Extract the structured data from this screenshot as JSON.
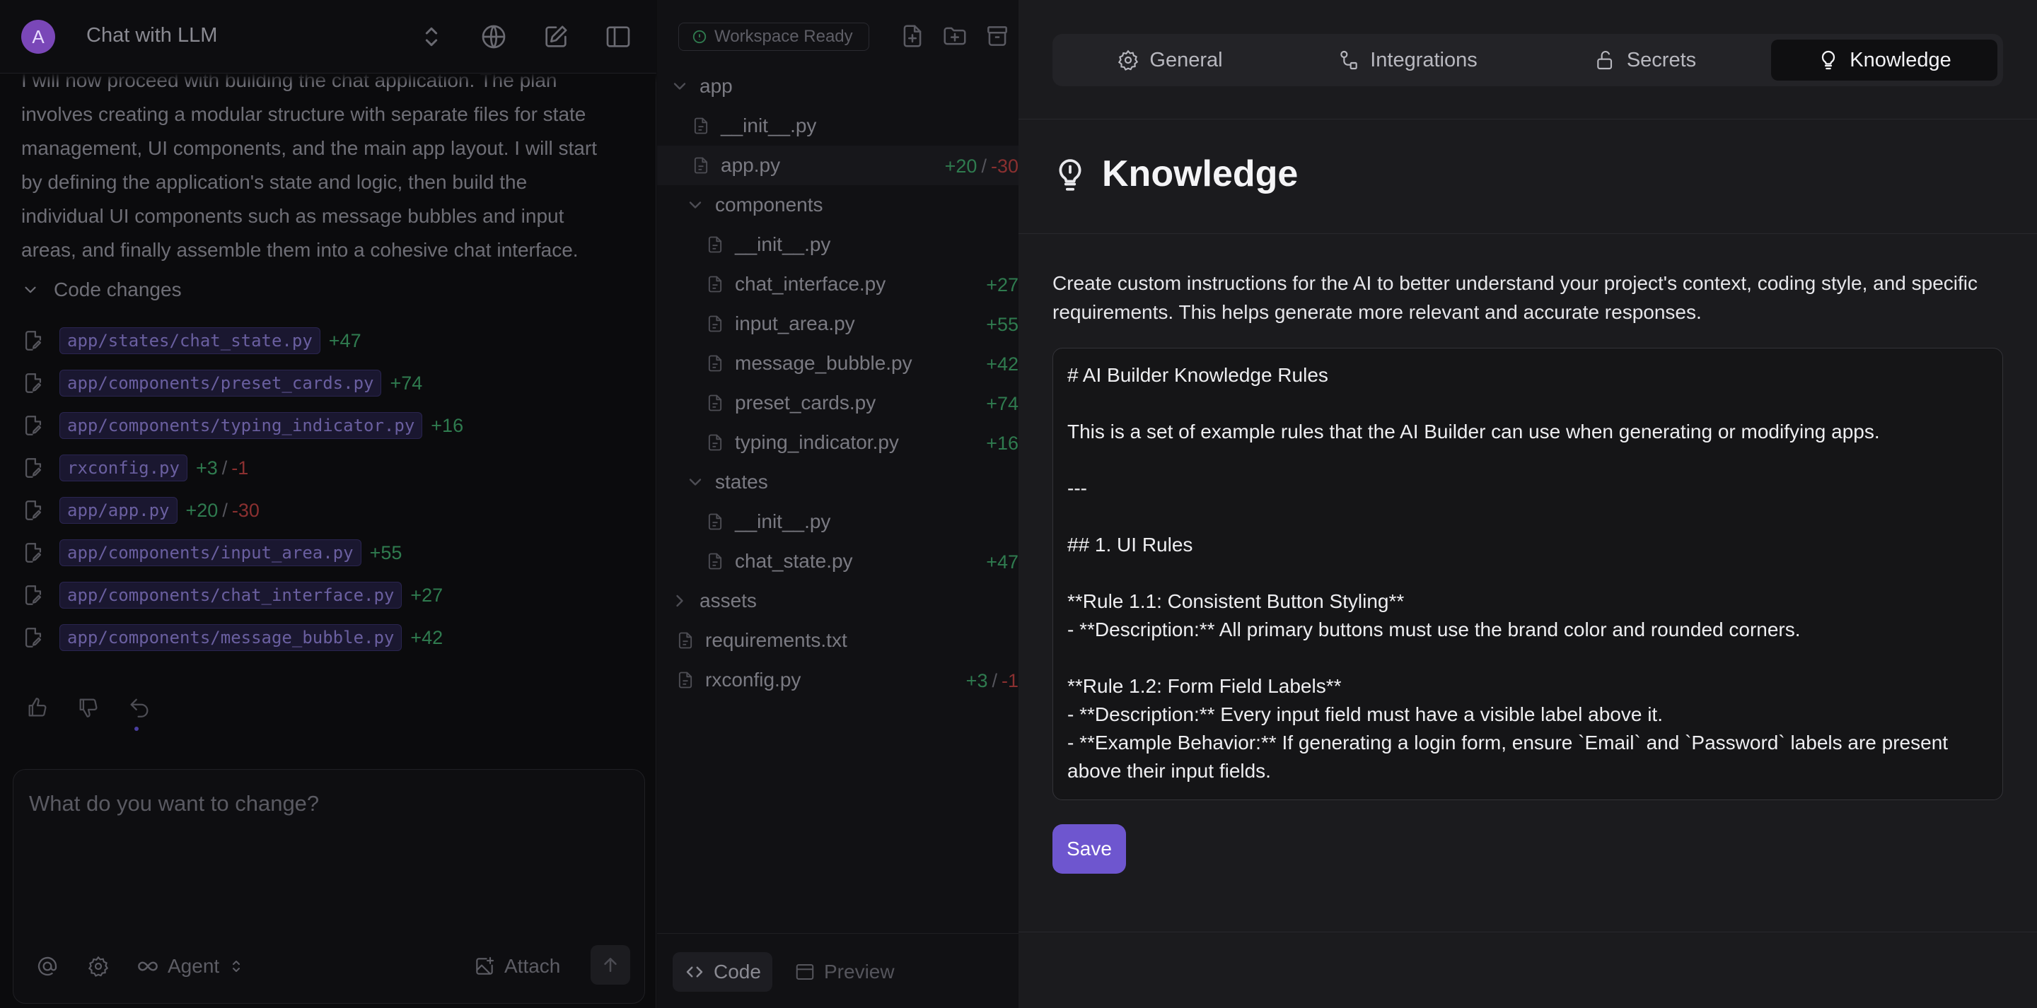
{
  "chat": {
    "avatar_letter": "A",
    "title": "Chat with LLM",
    "plan_lines": [
      "I will now proceed with building the chat application. The plan",
      "involves creating a modular structure with separate files for state",
      "management, UI components, and the main app layout. I will start",
      "by defining the application's state and logic, then build the",
      "individual UI components such as message bubbles and input",
      "areas, and finally assemble them into a cohesive chat interface."
    ],
    "code_changes_label": "Code changes",
    "code_changes": [
      {
        "file": "app/states/chat_state.py",
        "added": "+47",
        "removed": ""
      },
      {
        "file": "app/components/preset_cards.py",
        "added": "+74",
        "removed": ""
      },
      {
        "file": "app/components/typing_indicator.py",
        "added": "+16",
        "removed": ""
      },
      {
        "file": "rxconfig.py",
        "added": "+3",
        "removed": "-1"
      },
      {
        "file": "app/app.py",
        "added": "+20",
        "removed": "-30"
      },
      {
        "file": "app/components/input_area.py",
        "added": "+55",
        "removed": ""
      },
      {
        "file": "app/components/chat_interface.py",
        "added": "+27",
        "removed": ""
      },
      {
        "file": "app/components/message_bubble.py",
        "added": "+42",
        "removed": ""
      }
    ],
    "diff_separator": "/",
    "composer": {
      "placeholder": "What do you want to change?",
      "mode_label": "Agent",
      "attach_label": "Attach"
    }
  },
  "workspace": {
    "status": "Workspace Ready",
    "tree": [
      {
        "name": "app",
        "type": "folder-open",
        "depth": 0,
        "added": "",
        "removed": ""
      },
      {
        "name": "__init__.py",
        "type": "file",
        "depth": 1,
        "added": "",
        "removed": ""
      },
      {
        "name": "app.py",
        "type": "file",
        "depth": 1,
        "added": "+20",
        "removed": "-30",
        "active": true
      },
      {
        "name": "components",
        "type": "folder-open",
        "depth": 1,
        "added": "",
        "removed": ""
      },
      {
        "name": "__init__.py",
        "type": "file",
        "depth": 2,
        "added": "",
        "removed": ""
      },
      {
        "name": "chat_interface.py",
        "type": "file",
        "depth": 2,
        "added": "+27",
        "removed": ""
      },
      {
        "name": "input_area.py",
        "type": "file",
        "depth": 2,
        "added": "+55",
        "removed": ""
      },
      {
        "name": "message_bubble.py",
        "type": "file",
        "depth": 2,
        "added": "+42",
        "removed": ""
      },
      {
        "name": "preset_cards.py",
        "type": "file",
        "depth": 2,
        "added": "+74",
        "removed": ""
      },
      {
        "name": "typing_indicator.py",
        "type": "file",
        "depth": 2,
        "added": "+16",
        "removed": ""
      },
      {
        "name": "states",
        "type": "folder-open",
        "depth": 1,
        "added": "",
        "removed": ""
      },
      {
        "name": "__init__.py",
        "type": "file",
        "depth": 2,
        "added": "",
        "removed": ""
      },
      {
        "name": "chat_state.py",
        "type": "file",
        "depth": 2,
        "added": "+47",
        "removed": ""
      },
      {
        "name": "assets",
        "type": "folder-closed",
        "depth": 0,
        "added": "",
        "removed": ""
      },
      {
        "name": "requirements.txt",
        "type": "file",
        "depth": 0,
        "added": "",
        "removed": ""
      },
      {
        "name": "rxconfig.py",
        "type": "file",
        "depth": 0,
        "added": "+3",
        "removed": "-1"
      }
    ],
    "view_tabs": {
      "code": "Code",
      "preview": "Preview"
    }
  },
  "settings": {
    "tabs": [
      {
        "label": "General",
        "icon": "gear-icon"
      },
      {
        "label": "Integrations",
        "icon": "integrations-icon"
      },
      {
        "label": "Secrets",
        "icon": "lock-icon"
      },
      {
        "label": "Knowledge",
        "icon": "lightbulb-icon",
        "active": true
      }
    ],
    "title": "Knowledge",
    "description": "Create custom instructions for the AI to better understand your project's context, coding style, and specific requirements. This helps generate more relevant and accurate responses.",
    "rules_text": "# AI Builder Knowledge Rules\n\nThis is a set of example rules that the AI Builder can use when generating or modifying apps.\n\n---\n\n## 1. UI Rules\n\n**Rule 1.1: Consistent Button Styling**\n- **Description:** All primary buttons must use the brand color and rounded corners.\n\n**Rule 1.2: Form Field Labels**\n- **Description:** Every input field must have a visible label above it.\n- **Example Behavior:** If generating a login form, ensure `Email` and `Password` labels are present above their input fields.",
    "save_label": "Save"
  },
  "colors": {
    "accent": "#6e56cf",
    "added": "#2f7b4f",
    "removed": "#8a3030",
    "panel_bg": "#1b1b1e"
  }
}
